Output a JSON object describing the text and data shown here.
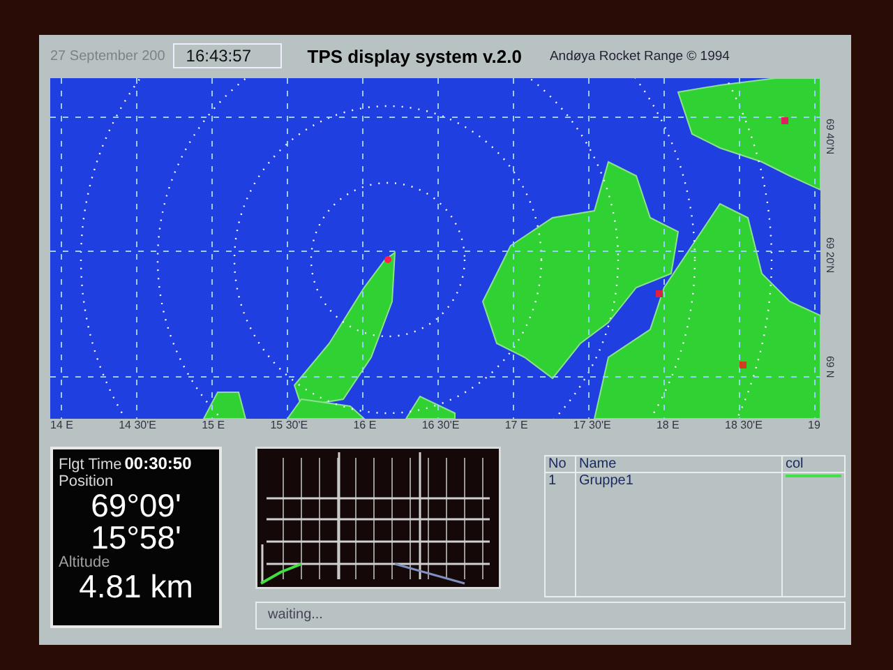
{
  "header": {
    "date": "27 September 200",
    "clock": "16:43:57",
    "title": "TPS display system v.2.0",
    "credit": "Andøya Rocket Range © 1994"
  },
  "map": {
    "longitude_labels": [
      "14 E",
      "14 30'E",
      "15 E",
      "15 30'E",
      "16 E",
      "16 30'E",
      "17 E",
      "17 30'E",
      "18 E",
      "18 30'E",
      "19"
    ],
    "latitude_labels": [
      "69 40'N",
      "69 20'N",
      "69 N"
    ]
  },
  "flight_info": {
    "flight_time_label": "Flgt Time",
    "flight_time": "00:30:50",
    "position_label": "Position",
    "latitude": "69°09'",
    "longitude": "15°58'",
    "altitude_label": "Altitude",
    "altitude": "4.81 km"
  },
  "status": {
    "value": "waiting..."
  },
  "table": {
    "columns": [
      "No",
      "Name",
      "col"
    ],
    "rows": [
      {
        "no": "1",
        "name": "Gruppe1",
        "color": "#44e04a"
      }
    ]
  }
}
